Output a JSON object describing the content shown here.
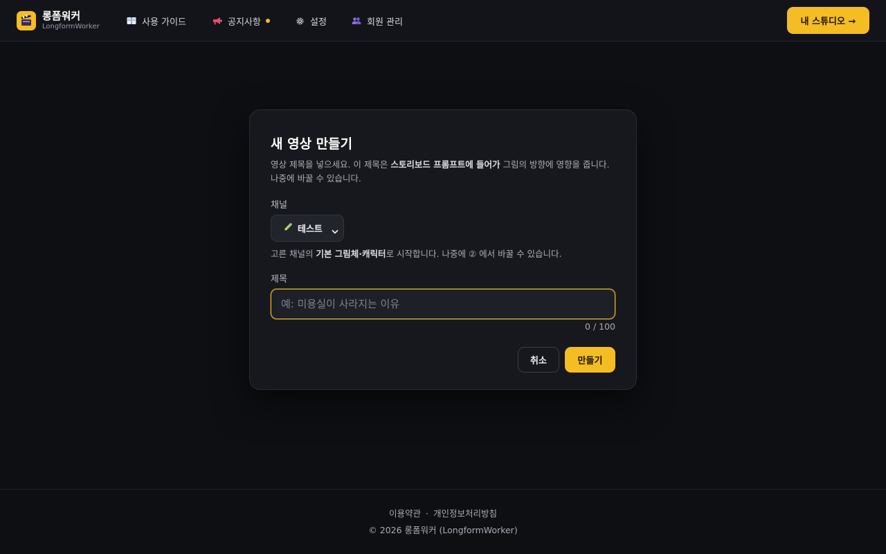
{
  "brand": {
    "name": "롱폼워커",
    "subtitle": "LongformWorker"
  },
  "nav": {
    "items": [
      {
        "label": "사용 가이드",
        "icon": "book-icon"
      },
      {
        "label": "공지사항",
        "icon": "megaphone-icon",
        "has_badge_dot": true
      },
      {
        "label": "설정",
        "icon": "gear-icon"
      },
      {
        "label": "회원 관리",
        "icon": "users-icon"
      }
    ],
    "studio_button": "내 스튜디오 →"
  },
  "dialog": {
    "title": "새 영상 만들기",
    "desc_part1": "영상 제목을 넣으세요. 이 제목은 ",
    "desc_bold": "스토리보드 프롬프트에 들어가",
    "desc_part2": " 그림의 방향에 영향을 줍니다. 나중에 바꿀 수 있습니다.",
    "channel_label": "채널",
    "channel_value": "테스트",
    "channel_icon": "pencil-icon",
    "hint_part1": "고른 채널의 ",
    "hint_bold": "기본 그림체·캐릭터",
    "hint_part2": "로 시작합니다. 나중에 ② 에서 바꿀 수 있습니다.",
    "title_label": "제목",
    "title_value": "",
    "title_placeholder": "예: 미용실이 사라지는 이유",
    "char_counter": "0 / 100",
    "cancel_label": "취소",
    "create_label": "만들기"
  },
  "footer": {
    "terms": "이용약관",
    "separator": "·",
    "privacy": "개인정보처리방침",
    "copyright": "© 2026 롱폼워커 (LongformWorker)"
  },
  "colors": {
    "accent": "#f5bd24",
    "background": "#0e0f13",
    "card": "#17181d"
  }
}
